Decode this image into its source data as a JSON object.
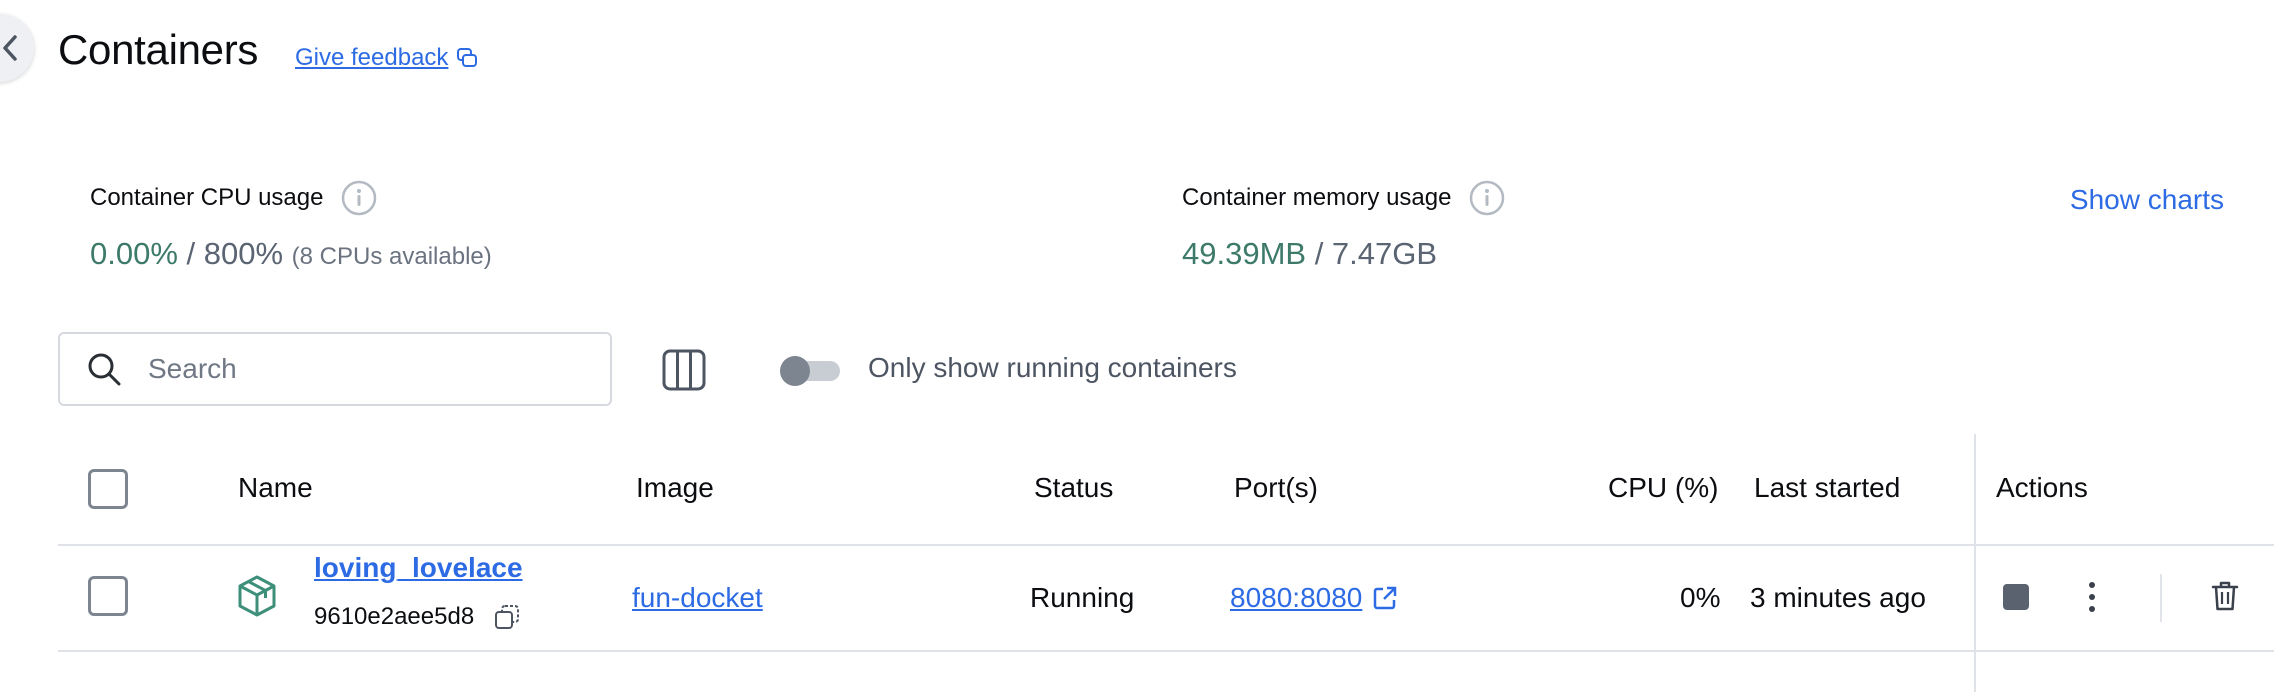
{
  "header": {
    "title": "Containers",
    "feedback_label": "Give feedback"
  },
  "stats": {
    "cpu": {
      "label": "Container CPU usage",
      "used": "0.00%",
      "separator": " / ",
      "total": "800%",
      "note": "(8 CPUs available)"
    },
    "memory": {
      "label": "Container memory usage",
      "used": "49.39MB",
      "separator": " / ",
      "total": "7.47GB"
    },
    "show_charts_label": "Show charts"
  },
  "toolbar": {
    "search_placeholder": "Search",
    "search_value": "",
    "running_toggle_label": "Only show running containers",
    "running_toggle_on": false
  },
  "table": {
    "columns": {
      "name": "Name",
      "image": "Image",
      "status": "Status",
      "ports": "Port(s)",
      "cpu": "CPU (%)",
      "last_started": "Last started",
      "actions": "Actions"
    },
    "rows": [
      {
        "name": "loving_lovelace",
        "id": "9610e2aee5d8",
        "image": "fun-docket",
        "status": "Running",
        "ports": "8080:8080",
        "cpu": "0%",
        "last_started": "3 minutes ago"
      }
    ]
  },
  "colors": {
    "accent_link": "#2d6be4",
    "accent_stat": "#3d7a6a",
    "divider": "#dfe2e6"
  },
  "icons": [
    "back-chevron-icon",
    "feedback-icon",
    "info-icon",
    "search-icon",
    "columns-icon",
    "container-cube-icon",
    "copy-icon",
    "external-link-icon",
    "stop-icon",
    "more-vertical-icon",
    "trash-icon"
  ]
}
